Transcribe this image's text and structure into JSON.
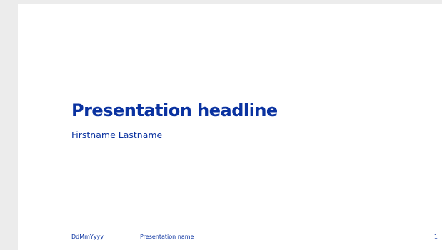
{
  "slide": {
    "headline": "Presentation headline",
    "presenter": "Firstname Lastname",
    "footer": {
      "date": "DdMmYyyy",
      "presentation_name": "Presentation name",
      "page_number": "1"
    }
  },
  "colors": {
    "brand_blue": "#0a32a0",
    "canvas_background": "#ececec",
    "slide_background": "#ffffff"
  }
}
